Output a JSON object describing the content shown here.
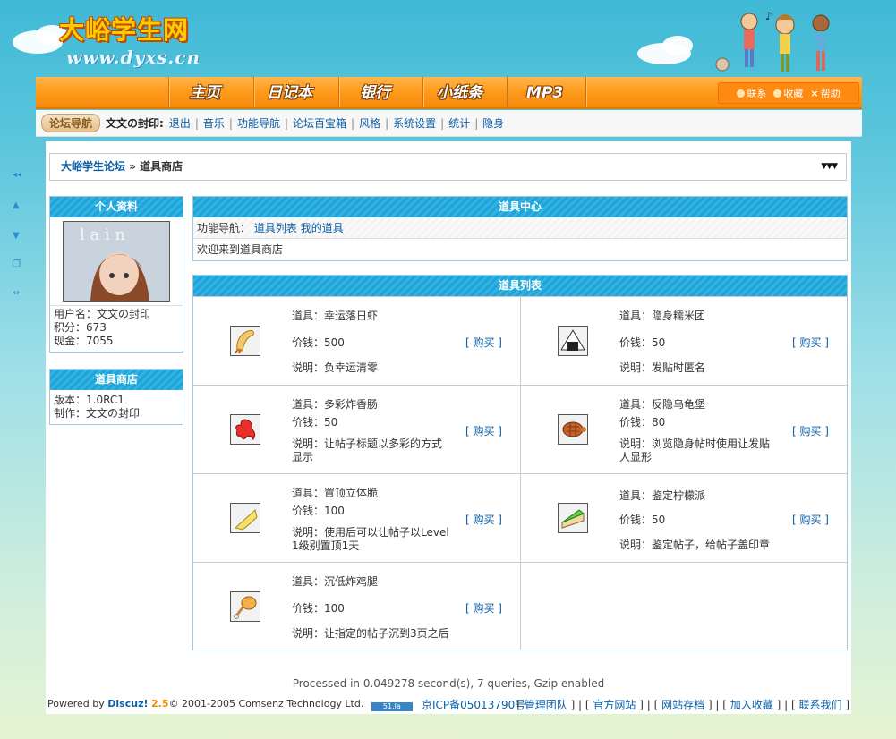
{
  "site": {
    "title": "大峪学生网",
    "url": "www.dyxs.cn"
  },
  "nav": {
    "items": [
      "主页",
      "日记本",
      "银行",
      "小纸条",
      "MP3"
    ],
    "toplinks": [
      "联系",
      "收藏",
      "帮助"
    ]
  },
  "menu": {
    "forum_nav": "论坛导航",
    "username": "文文の封印:",
    "links": [
      "退出",
      "音乐",
      "功能导航",
      "论坛百宝箱",
      "风格",
      "系统设置",
      "统计",
      "隐身"
    ]
  },
  "breadcrumb": {
    "forum": "大峪学生论坛",
    "sep": "»",
    "current": "道具商店"
  },
  "profile": {
    "header": "个人资料",
    "username_label": "用户名：",
    "username": "文文の封印",
    "points_label": "积分：",
    "points": "673",
    "cash_label": "现金：",
    "cash": "7055"
  },
  "shopinfo": {
    "header": "道具商店",
    "version_label": "版本：",
    "version": "1.0RC1",
    "author_label": "制作：",
    "author": "文文の封印"
  },
  "center": {
    "header": "道具中心",
    "nav_label": "功能导航：",
    "nav_links": [
      "道具列表",
      "我的道具"
    ],
    "welcome": "欢迎来到道具商店"
  },
  "items": {
    "header": "道具列表",
    "name_label": "道具：",
    "price_label": "价钱：",
    "desc_label": "说明：",
    "buy_label": "[ 购买 ]",
    "list": [
      {
        "name": "幸运落日虾",
        "price": "500",
        "desc": "负幸运清零",
        "icon": "shrimp-icon"
      },
      {
        "name": "隐身糯米团",
        "price": "50",
        "desc": "发贴时匿名",
        "icon": "rice-ball-icon"
      },
      {
        "name": "多彩炸香肠",
        "price": "50",
        "desc": "让帖子标题以多彩的方式显示",
        "icon": "sausage-icon"
      },
      {
        "name": "反隐乌龟堡",
        "price": "80",
        "desc": "浏览隐身帖时使用让发贴人显形",
        "icon": "turtle-burger-icon"
      },
      {
        "name": "置顶立体脆",
        "price": "100",
        "desc": "使用后可以让帖子以Level 1级别置顶1天",
        "icon": "cone-icon"
      },
      {
        "name": "鉴定柠檬派",
        "price": "50",
        "desc": "鉴定帖子，给帖子盖印章",
        "icon": "lemon-pie-icon"
      },
      {
        "name": "沉低炸鸡腿",
        "price": "100",
        "desc": "让指定的帖子沉到3页之后",
        "icon": "drumstick-icon"
      }
    ]
  },
  "footer": {
    "processed": "Processed in 0.049278 second(s), 7 queries, Gzip enabled",
    "powered_prefix": "Powered by ",
    "powered_brand": "Discuz!",
    "powered_version": "2.5",
    "copyright": "© 2001-2005 Comsenz Technology Ltd.",
    "stat_badge": "51.la",
    "icp": "京ICP备05013790号",
    "links": [
      "管理团队",
      "官方网站",
      "网站存档",
      "加入收藏",
      "联系我们"
    ]
  }
}
